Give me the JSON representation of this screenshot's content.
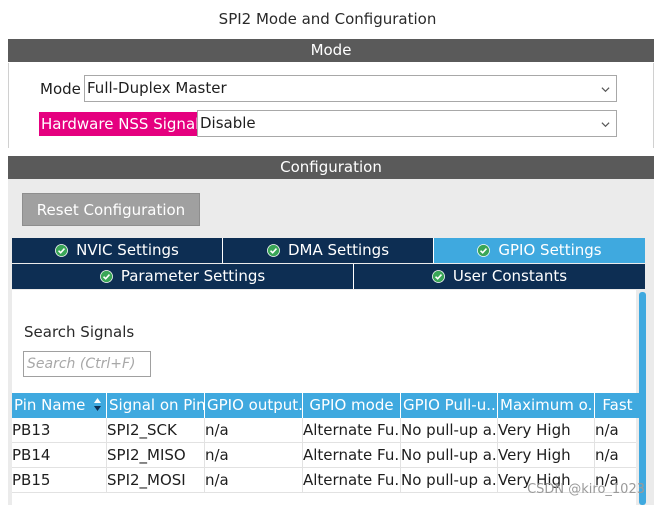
{
  "window": {
    "title": "SPI2 Mode and Configuration"
  },
  "mode_section": {
    "header": "Mode",
    "mode_label": "Mode",
    "mode_value": "Full-Duplex Master",
    "nss_label": "Hardware NSS Signal",
    "nss_value": "Disable"
  },
  "config_section": {
    "header": "Configuration",
    "reset_button": "Reset Configuration",
    "tabs": [
      {
        "label": "NVIC Settings",
        "active": false
      },
      {
        "label": "DMA Settings",
        "active": false
      },
      {
        "label": "GPIO Settings",
        "active": true
      },
      {
        "label": "Parameter Settings",
        "active": false
      },
      {
        "label": "User Constants",
        "active": false
      }
    ]
  },
  "search": {
    "label": "Search Signals",
    "placeholder": "Search (Ctrl+F)"
  },
  "table": {
    "headers": [
      "Pin Name",
      "Signal on Pin",
      "GPIO output...",
      "GPIO mode",
      "GPIO Pull-u...",
      "Maximum o...",
      "Fast"
    ],
    "rows": [
      [
        "PB13",
        "SPI2_SCK",
        "n/a",
        "Alternate Fu...",
        "No pull-up a...",
        "Very High",
        "n/a"
      ],
      [
        "PB14",
        "SPI2_MISO",
        "n/a",
        "Alternate Fu...",
        "No pull-up a...",
        "Very High",
        "n/a"
      ],
      [
        "PB15",
        "SPI2_MOSI",
        "n/a",
        "Alternate Fu...",
        "No pull-up a...",
        "Very High",
        "n/a"
      ]
    ]
  },
  "watermark": "CSDN @kiro_1023",
  "colors": {
    "header_gray": "#5a5a5a",
    "tab_navy": "#0d2e53",
    "accent_blue": "#3fa9df",
    "nss_magenta": "#e5007f",
    "check_green": "#3aa657"
  }
}
